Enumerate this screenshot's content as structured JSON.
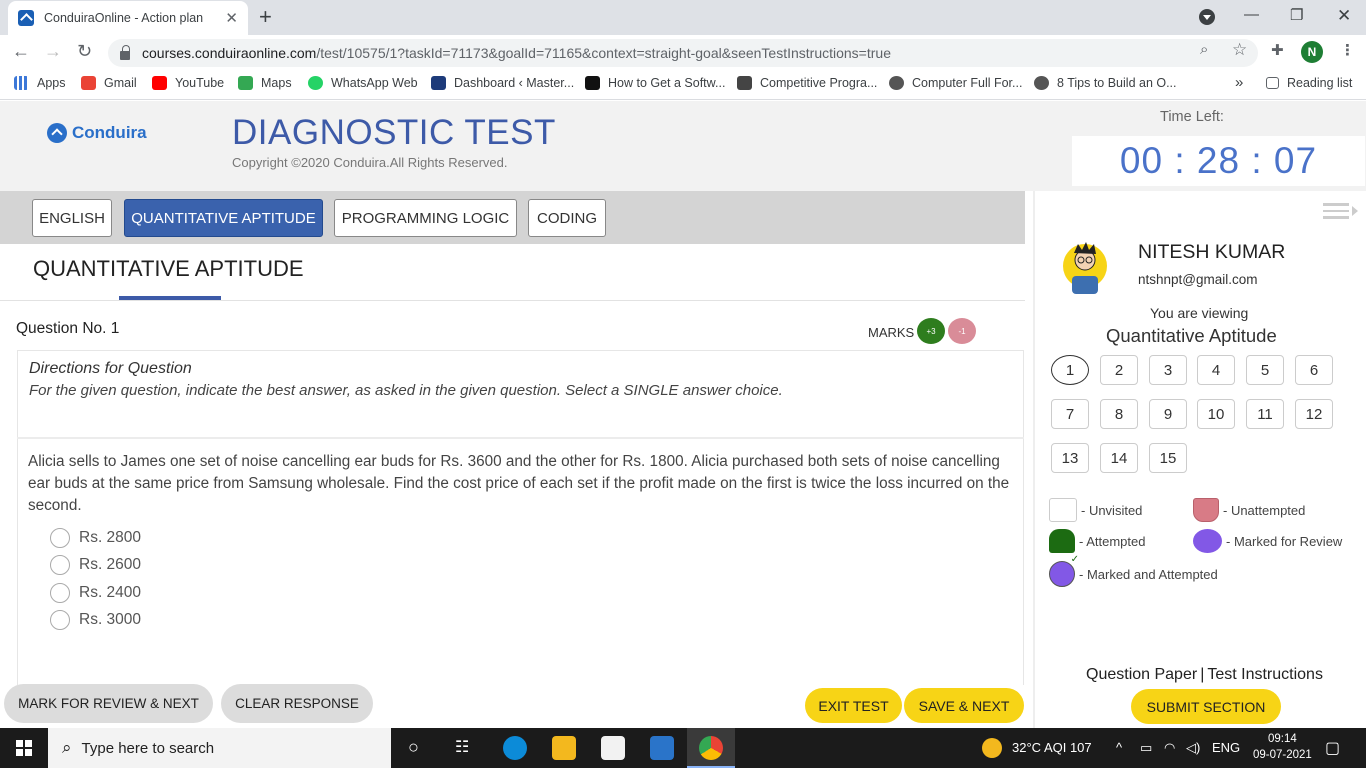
{
  "browser": {
    "tab_title": "ConduiraOnline - Action plan",
    "tab_close": "✕",
    "new_tab": "+",
    "url_host": "courses.conduiraonline.com",
    "url_path": "/test/10575/1?taskId=71173&goalId=71165&context=straight-goal&seenTestInstructions=true",
    "profile_initial": "N",
    "bookmarks": [
      {
        "label": "Apps",
        "color": "#3c78d8"
      },
      {
        "label": "Gmail",
        "color": "#ea4335"
      },
      {
        "label": "YouTube",
        "color": "#ff0000"
      },
      {
        "label": "Maps",
        "color": "#34a853"
      },
      {
        "label": "WhatsApp Web",
        "color": "#25d366"
      },
      {
        "label": "Dashboard ‹ Master...",
        "color": "#1d3b7a"
      },
      {
        "label": "How to Get a Softw...",
        "color": "#111111"
      },
      {
        "label": "Competitive Progra...",
        "color": "#444444"
      },
      {
        "label": "Computer Full For...",
        "color": "#555555"
      },
      {
        "label": "8 Tips to Build an O...",
        "color": "#555555"
      }
    ],
    "bookmarks_overflow": "»",
    "reading_list": "Reading list"
  },
  "header": {
    "brand": "Conduira",
    "title": "DIAGNOSTIC TEST",
    "copyright": "Copyright ©2020 Conduira.All Rights Reserved.",
    "time_label": "Time Left:",
    "timer": "00 : 28 : 07"
  },
  "sections": [
    {
      "label": "ENGLISH",
      "active": false
    },
    {
      "label": "QUANTITATIVE APTITUDE",
      "active": true
    },
    {
      "label": "PROGRAMMING LOGIC",
      "active": false
    },
    {
      "label": "CODING",
      "active": false
    }
  ],
  "main": {
    "section_heading": "QUANTITATIVE APTITUDE",
    "question_number": "Question No. 1",
    "marks_label": "MARKS",
    "marks_positive": "+3",
    "marks_negative": "-1",
    "directions_title": "Directions for Question",
    "directions_body": "For the given question, indicate the best answer, as asked in the given question. Select a SINGLE answer choice.",
    "question": "Alicia sells to James one set of noise cancelling ear buds for Rs. 3600 and the other for Rs. 1800. Alicia purchased both sets of noise cancelling ear buds at the same price from Samsung wholesale. Find the cost price of each set if the profit made on the first is twice the loss incurred on the second.",
    "options": [
      "Rs. 2800",
      "Rs. 2600",
      "Rs. 2400",
      "Rs. 3000"
    ]
  },
  "actions": {
    "mark_review": "MARK FOR REVIEW & NEXT",
    "clear": "CLEAR RESPONSE",
    "exit": "EXIT TEST",
    "save_next": "SAVE & NEXT",
    "submit": "SUBMIT SECTION"
  },
  "sidebar": {
    "name": "NITESH KUMAR",
    "email": "ntshnpt@gmail.com",
    "viewing_label": "You are viewing",
    "viewing_section": "Quantitative Aptitude",
    "questions": [
      "1",
      "2",
      "3",
      "4",
      "5",
      "6",
      "7",
      "8",
      "9",
      "10",
      "11",
      "12",
      "13",
      "14",
      "15"
    ],
    "current_question": "1",
    "legend": {
      "unvisited": "- Unvisited",
      "unattempted": "- Unattempted",
      "attempted": "- Attempted",
      "review": "- Marked for Review",
      "review_attempted": "- Marked and Attempted"
    },
    "question_paper": "Question Paper",
    "link_sep": "|",
    "instructions": "Test Instructions"
  },
  "taskbar": {
    "search_placeholder": "Type here to search",
    "weather": "32°C  AQI 107",
    "lang": "ENG",
    "time": "09:14",
    "date": "09-07-2021"
  },
  "colors": {
    "primary_blue": "#3d5aa8",
    "active_tab": "#3a62ad",
    "yellow_button": "#f7d416",
    "marks_positive": "#2e7d1e",
    "marks_negative": "#d98c98",
    "attempted": "#1c6b12",
    "unattempted": "#d87b86",
    "review": "#8258e6"
  }
}
